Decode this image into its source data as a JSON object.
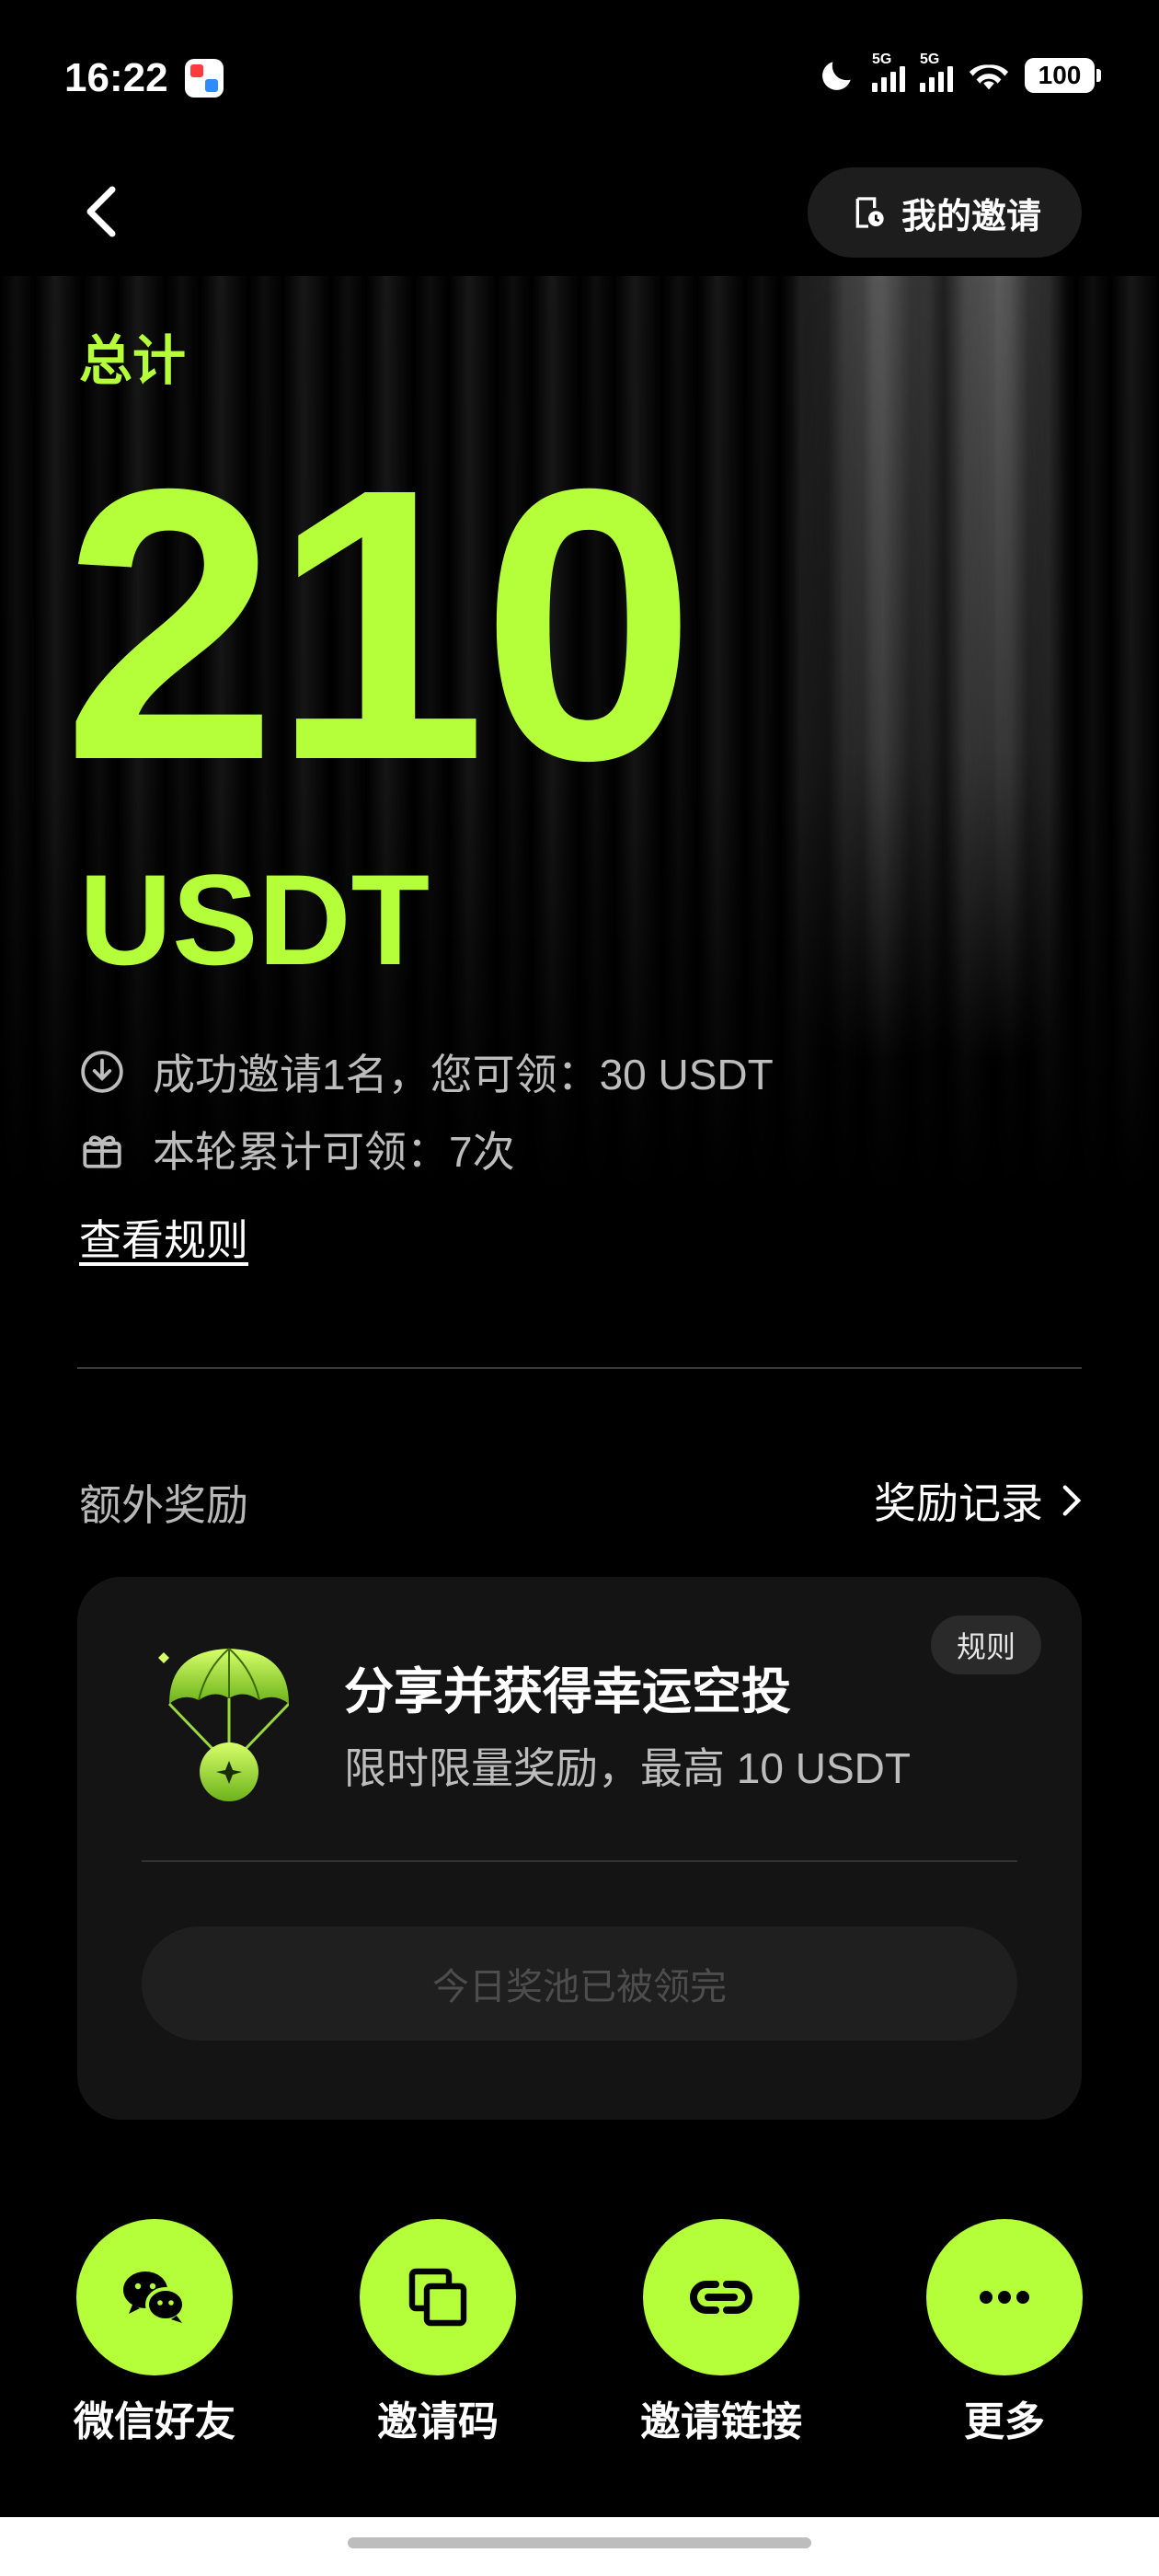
{
  "status_bar": {
    "time": "16:22",
    "network_1": "5G",
    "network_2": "5G",
    "battery": "100"
  },
  "header": {
    "my_invite_label": "我的邀请"
  },
  "summary": {
    "total_label": "总计",
    "amount": "210",
    "unit": "USDT",
    "invite_info": "成功邀请1名，您可领：30 USDT",
    "round_info": "本轮累计可领：7次",
    "rules_link": "查看规则"
  },
  "extra": {
    "title": "额外奖励",
    "record_label": "奖励记录",
    "card": {
      "rules_chip": "规则",
      "title": "分享并获得幸运空投",
      "subtitle": "限时限量奖励，最高 10 USDT",
      "claim_button": "今日奖池已被领完"
    }
  },
  "share": [
    {
      "label": "微信好友",
      "icon": "wechat-icon"
    },
    {
      "label": "邀请码",
      "icon": "copy-icon"
    },
    {
      "label": "邀请链接",
      "icon": "link-icon"
    },
    {
      "label": "更多",
      "icon": "more-icon"
    }
  ],
  "colors": {
    "accent": "#b4ff3a",
    "background": "#000000",
    "card": "#141414"
  }
}
